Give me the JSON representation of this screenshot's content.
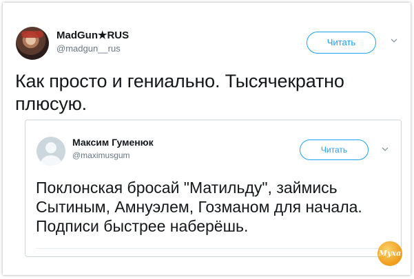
{
  "tweet": {
    "author_name": "MadGun★RUS",
    "author_handle": "@madgun__rus",
    "follow_label": "Читать",
    "text": "Как просто и гениально. Тысячекратно плюсую."
  },
  "quoted_tweet": {
    "author_name": "Максим Гуменюк",
    "author_handle": "@maximusgum",
    "follow_label": "Читать",
    "text": "Поклонская бросай \"Матильду\", займись Сытиным, Амнуэлем, Гозманом для начала. Подписи быстрее наберёшь."
  },
  "watermark": "Муха",
  "colors": {
    "accent": "#1da1f2",
    "text": "#14171a",
    "secondary": "#657786",
    "border": "#ccd6dd"
  },
  "icons": [
    "chevron-down-icon",
    "default-avatar-icon"
  ]
}
